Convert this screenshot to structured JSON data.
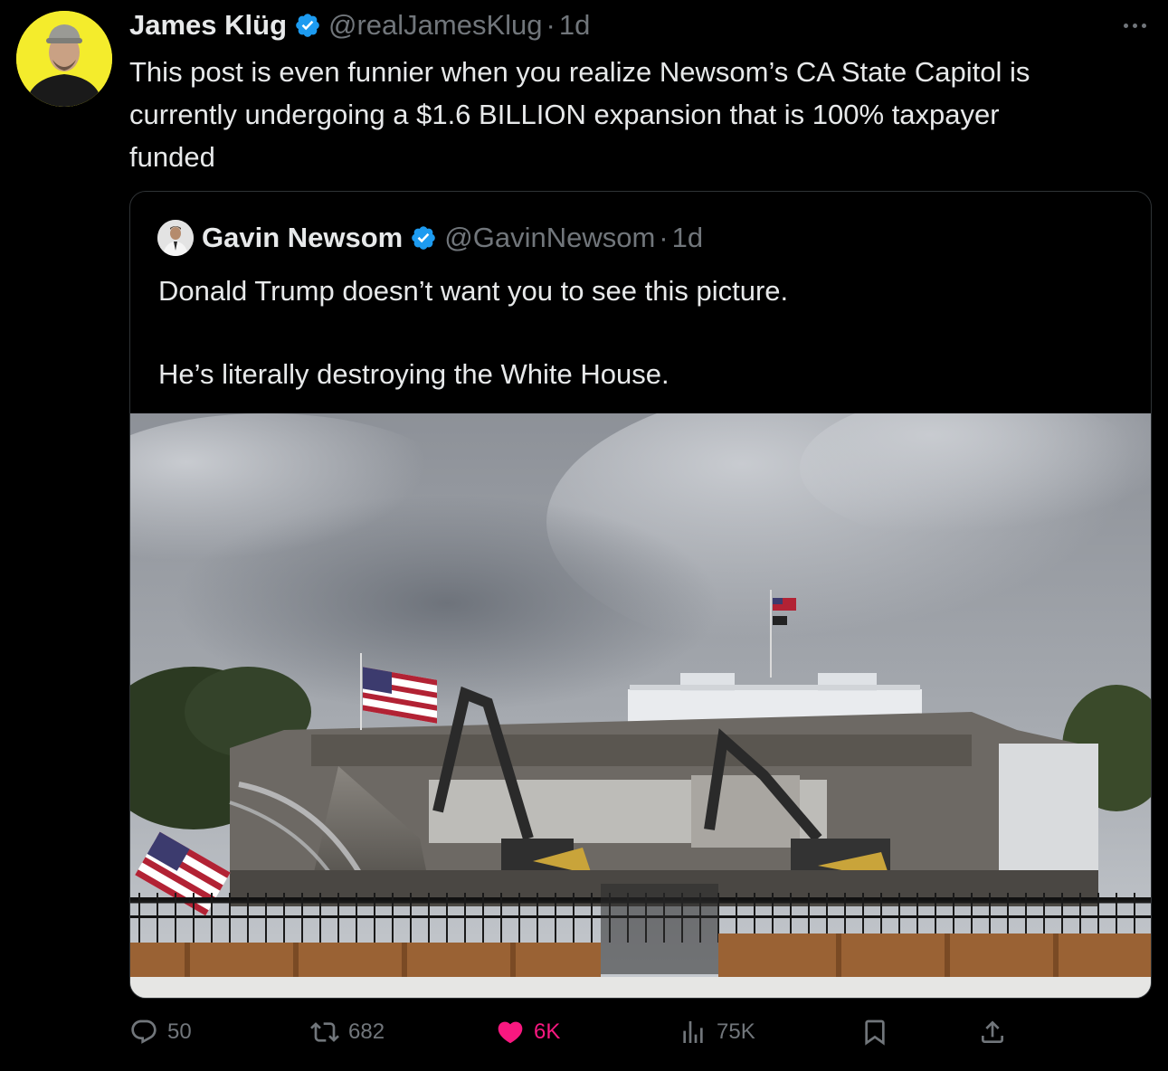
{
  "post": {
    "author_name": "James Klüg",
    "author_handle": "@realJamesKlug",
    "separator": "·",
    "time": "1d",
    "text": "This post is even funnier when you realize Newsom’s CA State Capitol is\ncurrently undergoing a $1.6 BILLION expansion that is 100% taxpayer\nfunded"
  },
  "quoted": {
    "author_name": "Gavin Newsom",
    "author_handle": "@GavinNewsom",
    "separator": "·",
    "time": "1d",
    "text": "Donald Trump doesn’t want you to see this picture.\n\nHe’s literally destroying the White House."
  },
  "actions": {
    "replies": "50",
    "reposts": "682",
    "likes": "6K",
    "views": "75K"
  },
  "colors": {
    "background": "#000000",
    "text": "#e7e9ea",
    "muted": "#71767b",
    "verified": "#1d9bf0",
    "like": "#f91880",
    "avatar_bg": "#f4ec2c"
  },
  "icons": [
    "more-icon",
    "verified-icon",
    "reply-icon",
    "repost-icon",
    "like-icon",
    "views-icon",
    "bookmark-icon",
    "share-icon"
  ]
}
